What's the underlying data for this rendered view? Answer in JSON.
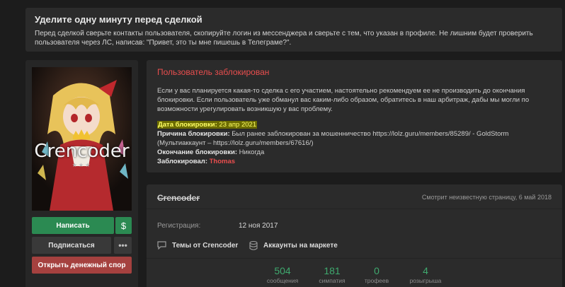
{
  "notice": {
    "title": "Уделите одну минуту перед сделкой",
    "text": "Перед сделкой сверьте контакты пользователя, скопируйте логин из мессенджера и сверьте с тем, что указан в профиле. Не лишним будет проверить пользователя через ЛС, написав: \"Привет, это ты мне пишешь в Телеграме?\"."
  },
  "avatar": {
    "name": "Crencoder",
    "stars": "★★★"
  },
  "actions": {
    "write": "Написать",
    "money_icon": "$",
    "follow": "Подписаться",
    "more": "•••",
    "dispute": "Открыть денежный спор"
  },
  "blocked": {
    "title": "Пользователь заблокирован",
    "description": "Если у вас планируется какая-то сделка с его участием, настоятельно рекомендуем ее не производить до окончания блокировки. Если пользователь уже обманул вас каким-либо образом, обратитесь в наш арбитраж, дабы мы могли по возможности урегулировать возникшую у вас проблему.",
    "date_label": "Дата блокировки:",
    "date_value": "23 апр 2021",
    "reason_label": "Причина блокировки:",
    "reason_value": "Был ранее заблокирован за мошенничество https://lolz.guru/members/85289/ - GoldStorm (Мультиаккаунт – https://lolz.guru/members/67616/)",
    "end_label": "Окончание блокировки:",
    "end_value": "Никогда",
    "by_label": "Заблокировал:",
    "by_value": "Thomas"
  },
  "profile": {
    "username": "Crencoder",
    "status": "Смотрит неизвестную страницу, 6 май 2018",
    "reg_label": "Регистрация:",
    "reg_value": "12 ноя 2017",
    "themes_link": "Темы от Crencoder",
    "accounts_link": "Аккаунты на маркете",
    "stats": [
      {
        "value": "504",
        "label": "сообщения"
      },
      {
        "value": "181",
        "label": "симпатия"
      },
      {
        "value": "0",
        "label": "трофеев"
      },
      {
        "value": "4",
        "label": "розыгрыша"
      }
    ]
  },
  "colors": {
    "accent_green": "#2b8a52",
    "danger_red": "#e94e4e",
    "highlight": "#ffff66"
  }
}
